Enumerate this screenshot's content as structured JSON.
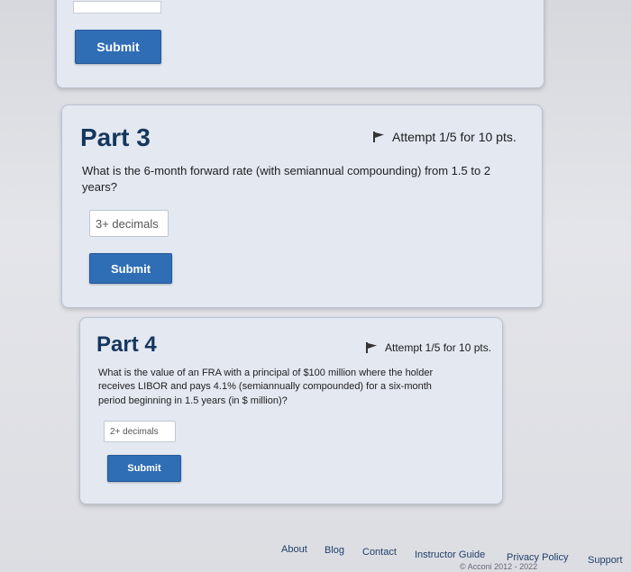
{
  "part2": {
    "submit_label": "Submit"
  },
  "part3": {
    "title": "Part 3",
    "attempt": "Attempt 1/5 for 10 pts.",
    "question_line1": "What is the 6-month forward rate (with semiannual compounding) from 1.5 to 2",
    "question_line2": "years?",
    "input_placeholder": "3+ decimals",
    "submit_label": "Submit"
  },
  "part4": {
    "title": "Part 4",
    "attempt": "Attempt 1/5 for 10 pts.",
    "question_line1": "What is the value of an FRA with a principal of $100 million where the holder",
    "question_line2": "receives LIBOR and pays 4.1% (semiannually compounded) for a six-month",
    "question_line3": "period beginning in 1.5 years (in $ million)?",
    "input_placeholder": "2+ decimals",
    "submit_label": "Submit"
  },
  "footer": {
    "links": [
      "About",
      "Blog",
      "Contact",
      "Instructor Guide",
      "Privacy Policy",
      "Support"
    ],
    "copyright": "© Acconi 2012 - 2022"
  },
  "colors": {
    "button": "#2f6db5",
    "title": "#15365e",
    "card": "#e3e8f1"
  }
}
